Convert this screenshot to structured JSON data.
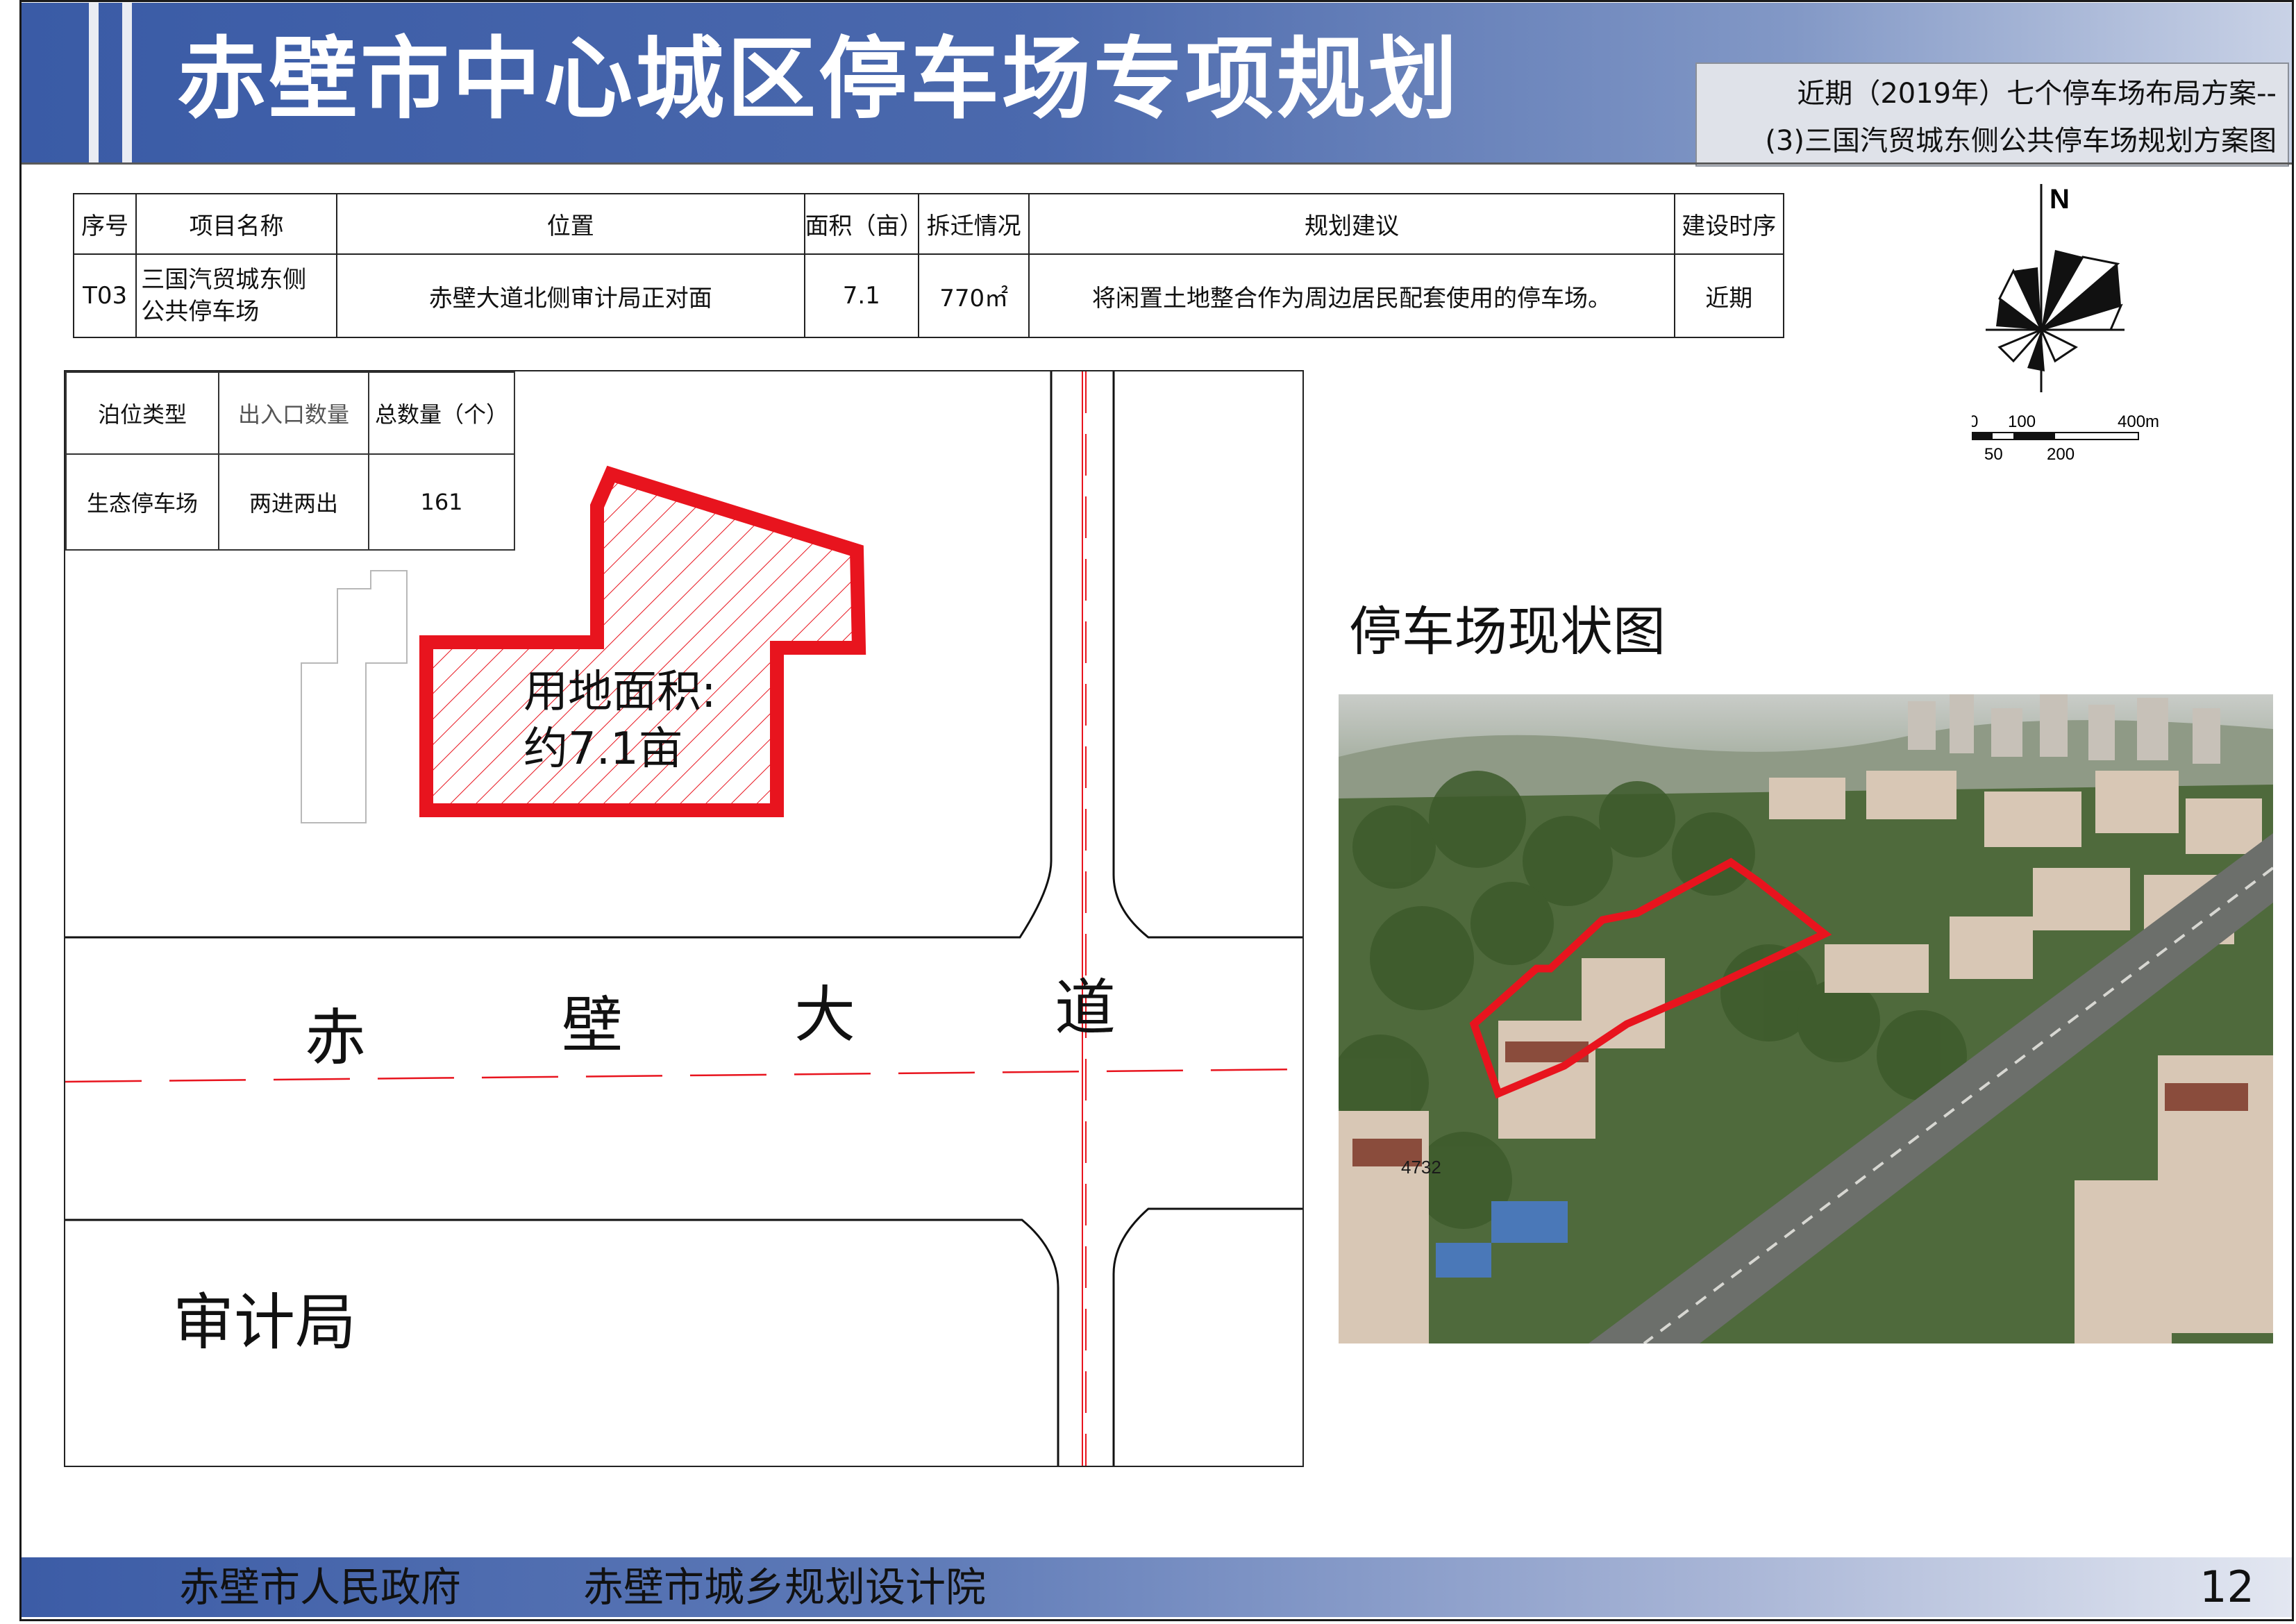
{
  "header": {
    "title": "赤壁市中心城区停车场专项规划",
    "subtitle_line1": "近期（2019年）七个停车场布局方案--",
    "subtitle_line2": "(3)三国汽贸城东侧公共停车场规划方案图"
  },
  "project_table": {
    "headers": [
      "序号",
      "项目名称",
      "位置",
      "面积（亩）",
      "拆迁情况",
      "规划建议",
      "建设时序"
    ],
    "row": {
      "id": "T03",
      "name_line1": "三国汽贸城东侧",
      "name_line2": "公共停车场",
      "location": "赤壁大道北侧审计局正对面",
      "area": "7.1",
      "demolition": "770㎡",
      "suggestion": "将闲置土地整合作为周边居民配套使用的停车场。",
      "phase": "近期"
    }
  },
  "stats_table": {
    "headers": [
      "泊位类型",
      "出入口数量",
      "总数量（个）"
    ],
    "row": [
      "生态停车场",
      "两进两出",
      "161"
    ]
  },
  "map": {
    "parcel_label_line1": "用地面积:",
    "parcel_label_line2": "约7.1亩",
    "road_chars": [
      "赤",
      "壁",
      "大",
      "道"
    ],
    "building_label": "审计局",
    "north_label": "N",
    "scale_top": [
      "0",
      "100",
      "400m"
    ],
    "scale_bottom": [
      "50",
      "200"
    ],
    "accent_color": "#e8141e"
  },
  "photo": {
    "title": "停车场现状图",
    "annotation": "4732"
  },
  "footer": {
    "left": "赤壁市人民政府",
    "right": "赤壁市城乡规划设计院",
    "page": "12"
  }
}
